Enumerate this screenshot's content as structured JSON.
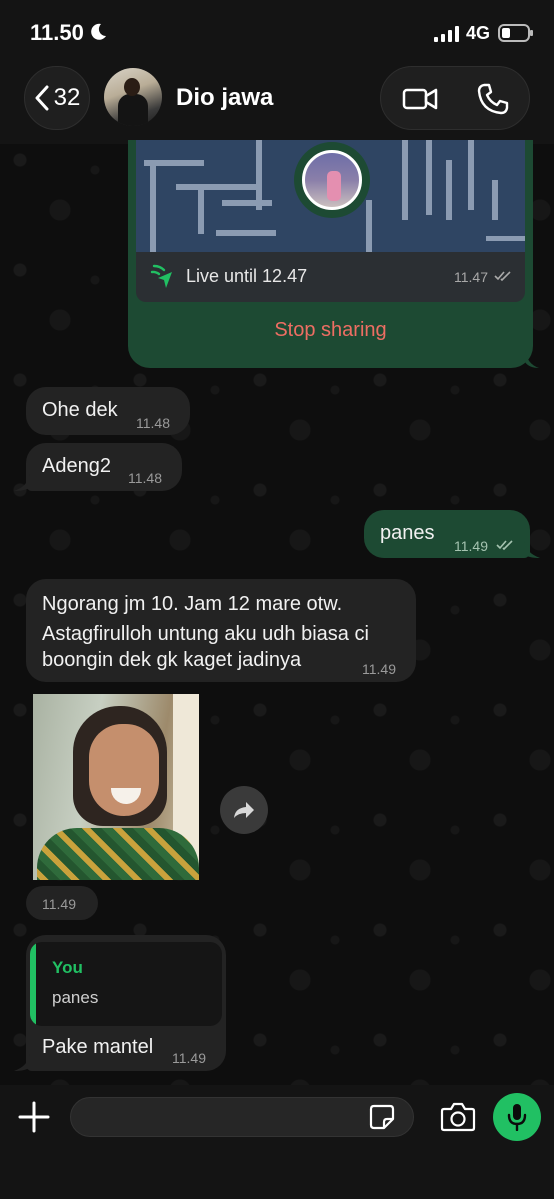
{
  "status_bar": {
    "time": "11.50",
    "network": "4G"
  },
  "header": {
    "back_count": "32",
    "contact_name": "Dio jawa"
  },
  "live_location": {
    "label": "Live until 12.47",
    "time": "11.47",
    "stop_label": "Stop sharing"
  },
  "messages": [
    {
      "direction": "in",
      "text": "Ohe dek",
      "time": "11.48"
    },
    {
      "direction": "in",
      "text": "Adeng2",
      "time": "11.48"
    },
    {
      "direction": "out",
      "text": "panes",
      "time": "11.49"
    },
    {
      "direction": "in",
      "lines": [
        "Ngorang jm 10. Jam 12 mare otw.",
        "Astagfirulloh untung aku udh biasa ci",
        "boongin dek gk kaget jadinya"
      ],
      "time": "11.49"
    },
    {
      "direction": "in",
      "type": "image",
      "time": "11.49"
    },
    {
      "direction": "in",
      "reply_to": {
        "author": "You",
        "text": "panes"
      },
      "text": "Pake mantel",
      "time": "11.49"
    }
  ],
  "colors": {
    "accent": "#21c063",
    "outgoing_bubble": "#1d4a33",
    "incoming_bubble": "#232323",
    "stop_sharing": "#ee6e63"
  },
  "icons": [
    "moon-icon",
    "signal-icon",
    "battery-icon",
    "chevron-left-icon",
    "video-call-icon",
    "phone-icon",
    "live-location-icon",
    "double-check-icon",
    "forward-icon",
    "plus-icon",
    "sticker-icon",
    "camera-icon",
    "microphone-icon"
  ]
}
